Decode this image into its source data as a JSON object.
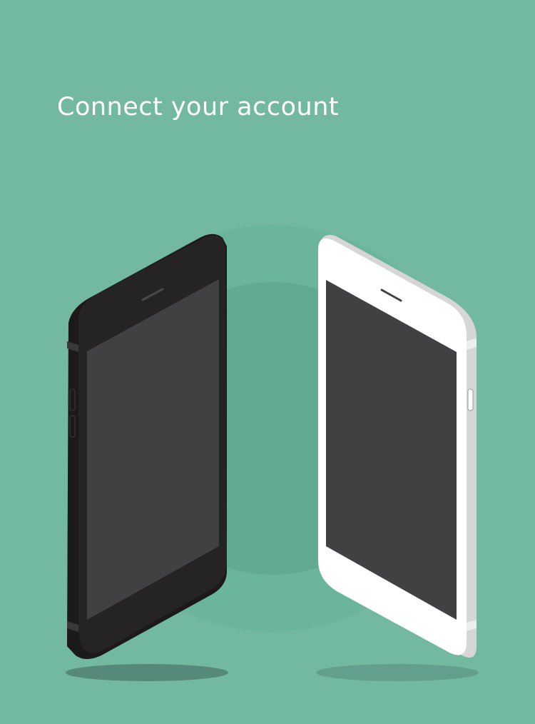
{
  "screen": {
    "title": "Connect your account",
    "background_color": "#73b9a0",
    "accent_color": "#62ab90"
  },
  "illustration": {
    "left_phone": {
      "icon": "phone-dark-icon",
      "body_color": "#262324",
      "screen_color": "#414042"
    },
    "right_phone": {
      "icon": "phone-light-icon",
      "body_color": "#ffffff",
      "edge_color": "#d6d6d6",
      "screen_color": "#414042"
    }
  }
}
